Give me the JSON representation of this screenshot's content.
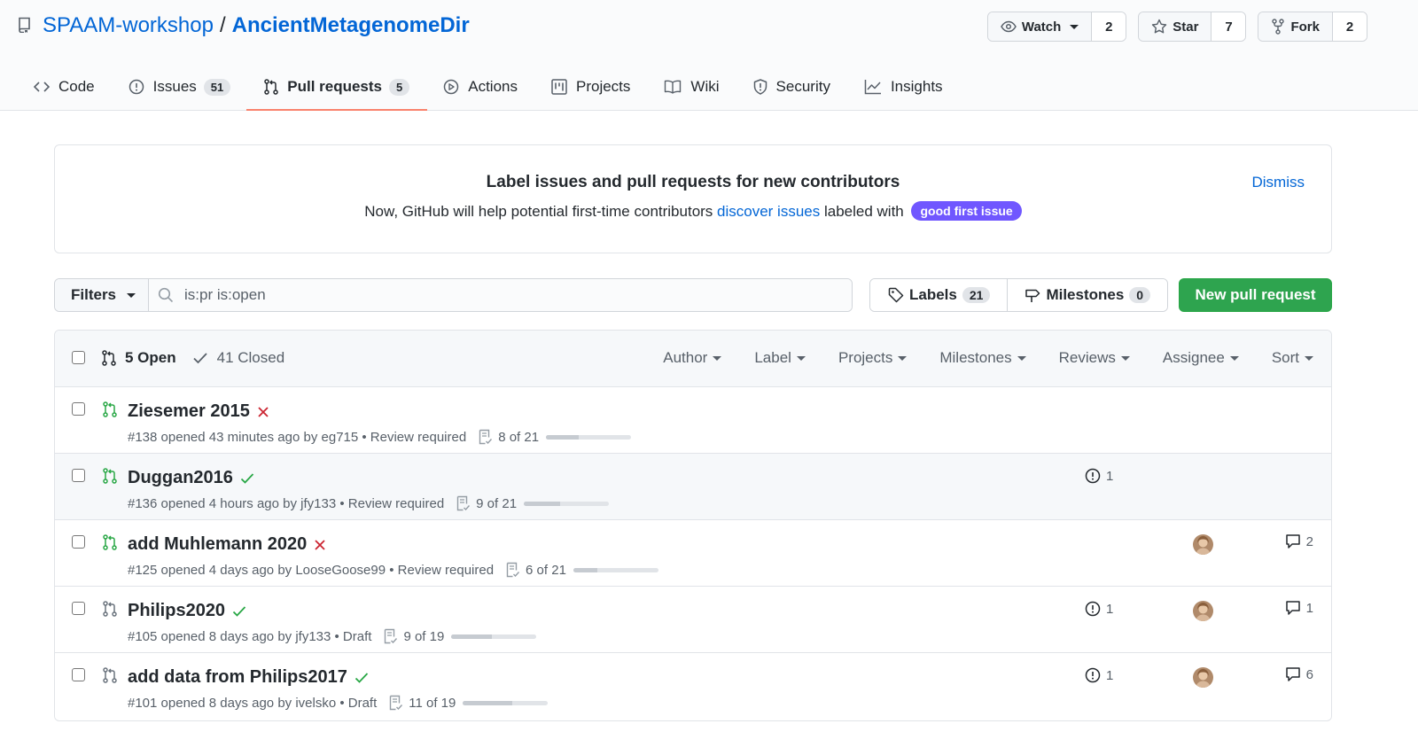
{
  "repo": {
    "owner": "SPAAM-workshop",
    "separator": "/",
    "name": "AncientMetagenomeDir"
  },
  "actions": {
    "watch": {
      "label": "Watch",
      "count": "2"
    },
    "star": {
      "label": "Star",
      "count": "7"
    },
    "fork": {
      "label": "Fork",
      "count": "2"
    }
  },
  "nav": {
    "code": "Code",
    "issues": {
      "label": "Issues",
      "count": "51"
    },
    "pulls": {
      "label": "Pull requests",
      "count": "5"
    },
    "actions": "Actions",
    "projects": "Projects",
    "wiki": "Wiki",
    "security": "Security",
    "insights": "Insights"
  },
  "banner": {
    "title": "Label issues and pull requests for new contributors",
    "desc_pre": "Now, GitHub will help potential first-time contributors ",
    "desc_link": "discover issues",
    "desc_post": " labeled with ",
    "label": "good first issue",
    "dismiss": "Dismiss"
  },
  "filters": {
    "label": "Filters",
    "query": "is:pr is:open"
  },
  "labels": {
    "label": "Labels",
    "count": "21"
  },
  "milestones": {
    "label": "Milestones",
    "count": "0"
  },
  "new_pr": "New pull request",
  "list": {
    "open": "5 Open",
    "closed": "41 Closed",
    "sorts": [
      "Author",
      "Label",
      "Projects",
      "Milestones",
      "Reviews",
      "Assignee",
      "Sort"
    ]
  },
  "prs": [
    {
      "title": "Ziesemer 2015",
      "status": "fail",
      "meta": "#138 opened 43 minutes ago by eg715 • Review required",
      "tasks": "8 of 21",
      "progress": 0.381,
      "draft": false
    },
    {
      "title": "Duggan2016",
      "status": "success",
      "meta": "#136 opened 4 hours ago by jfy133 • Review required",
      "tasks": "9 of 21",
      "progress": 0.429,
      "draft": false,
      "linked": "1"
    },
    {
      "title": "add Muhlemann 2020",
      "status": "fail",
      "meta": "#125 opened 4 days ago by LooseGoose99 • Review required",
      "tasks": "6 of 21",
      "progress": 0.286,
      "draft": false,
      "comments": "2",
      "avatar": true
    },
    {
      "title": "Philips2020",
      "status": "success",
      "meta": "#105 opened 8 days ago by jfy133 • Draft",
      "tasks": "9 of 19",
      "progress": 0.474,
      "draft": true,
      "linked": "1",
      "comments": "1",
      "avatar": true
    },
    {
      "title": "add data from Philips2017",
      "status": "success",
      "meta": "#101 opened 8 days ago by ivelsko • Draft",
      "tasks": "11 of 19",
      "progress": 0.579,
      "draft": true,
      "linked": "1",
      "comments": "6",
      "avatar": true
    }
  ],
  "colors": {
    "accent": "#0366d6",
    "success": "#28a745",
    "fail": "#cb2431",
    "label": "#7057ff",
    "nav_underline": "#f9826c"
  }
}
